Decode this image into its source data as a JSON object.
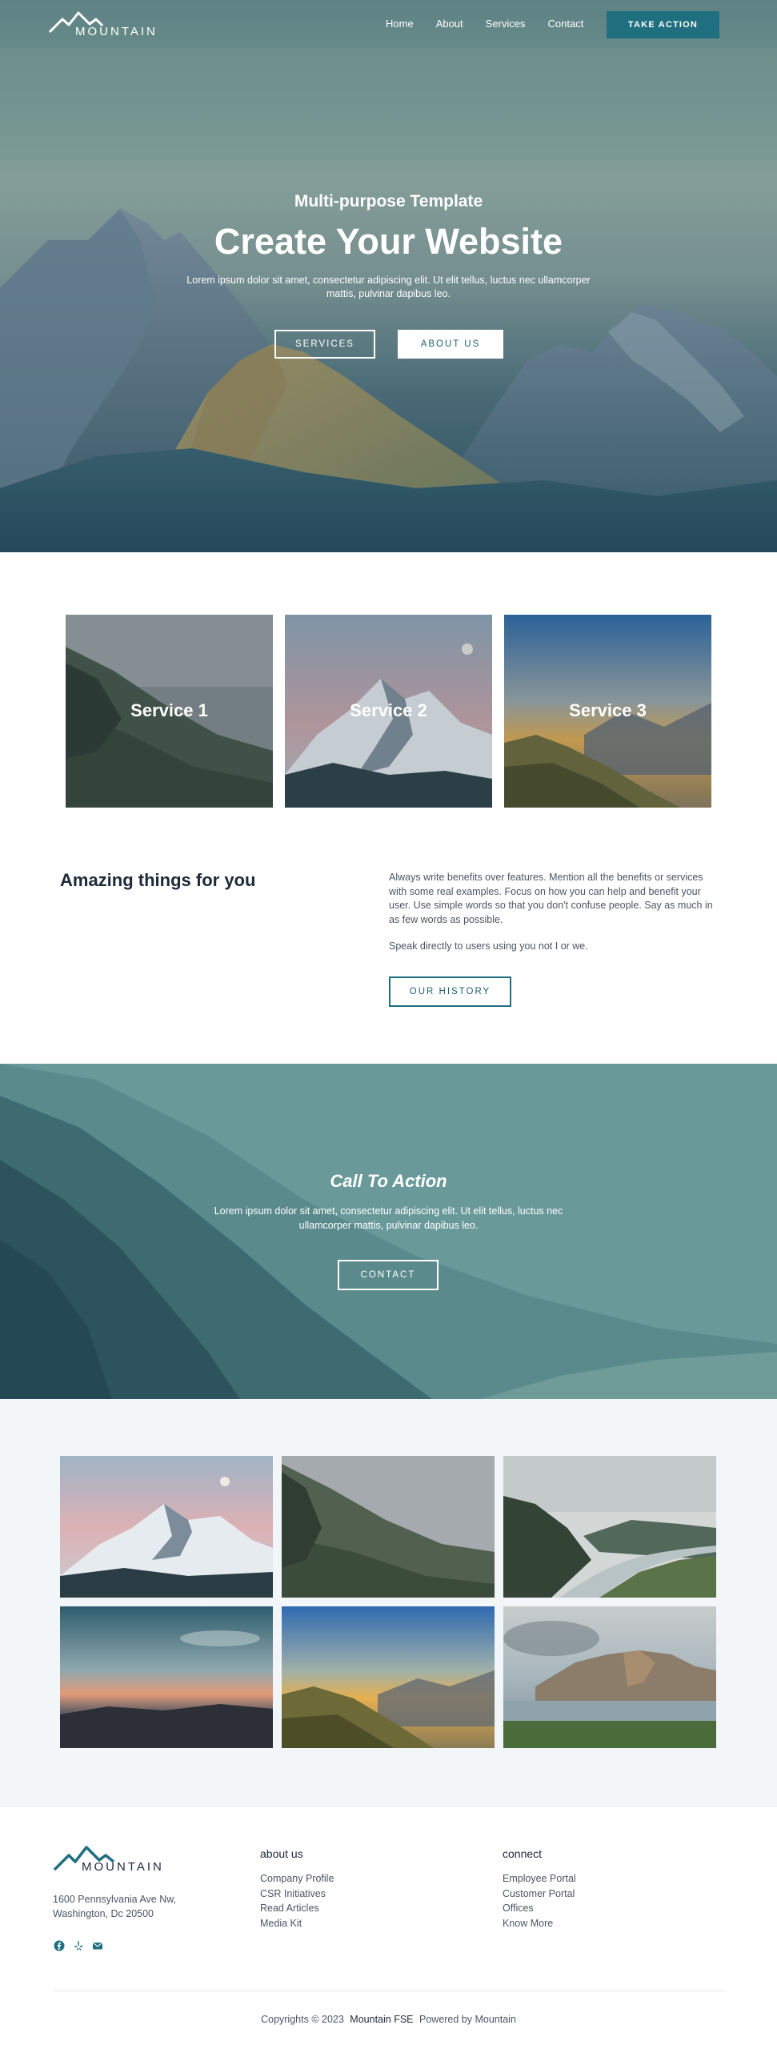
{
  "nav": {
    "logo_text": "MOUNTAIN",
    "links": [
      "Home",
      "About",
      "Services",
      "Contact"
    ],
    "cta_label": "TAKE ACTION"
  },
  "hero": {
    "subtitle": "Multi-purpose Template",
    "title": "Create Your Website",
    "text": "Lorem ipsum dolor sit amet, consectetur adipiscing elit. Ut elit tellus, luctus nec ullamcorper mattis, pulvinar dapibus leo.",
    "btn_services": "SERVICES",
    "btn_about": "ABOUT US"
  },
  "services": {
    "cards": [
      {
        "label": "Service 1"
      },
      {
        "label": "Service 2"
      },
      {
        "label": "Service 3"
      }
    ]
  },
  "amazing": {
    "title": "Amazing things for you",
    "paragraph1": "Always write benefits over features. Mention all the benefits or services with some real examples. Focus on how you can help and benefit your user. Use simple words so that you don't confuse people. Say as much in as few words as possible.",
    "paragraph2": "Speak directly to users using you not I or we.",
    "button": "OUR HISTORY"
  },
  "call_to_action": {
    "title": "Call To Action",
    "text": "Lorem ipsum dolor sit amet, consectetur adipiscing elit. Ut elit tellus, luctus nec ullamcorper mattis, pulvinar dapibus leo.",
    "button": "CONTACT"
  },
  "gallery": {
    "images": [
      "snowy-peaks-moon",
      "misty-forest-hills",
      "river-valley",
      "sunset-clouds",
      "golden-hour-ridge",
      "lake-mountains"
    ]
  },
  "footer": {
    "logo_text": "MOUNTAIN",
    "address_line1": "1600 Pennsylvania Ave Nw,",
    "address_line2": "Washington, Dc 20500",
    "social_icons": [
      "facebook-icon",
      "yelp-icon",
      "mail-icon"
    ],
    "col1_title": "about us",
    "col1_items": [
      "Company Profile",
      "CSR Initiatives",
      "Read Articles",
      "Media Kit"
    ],
    "col2_title": "connect",
    "col2_items": [
      "Employee Portal",
      "Customer Portal",
      "Offices",
      "Know More"
    ],
    "copyright_prefix": "Copyrights © 2023",
    "copyright_brand": "Mountain FSE",
    "copyright_suffix": "Powered by Mountain"
  },
  "colors": {
    "accent": "#1f6f80",
    "text_dark": "#1f2937",
    "text_muted": "#4b5563",
    "gallery_bg": "#f2f6f8"
  }
}
